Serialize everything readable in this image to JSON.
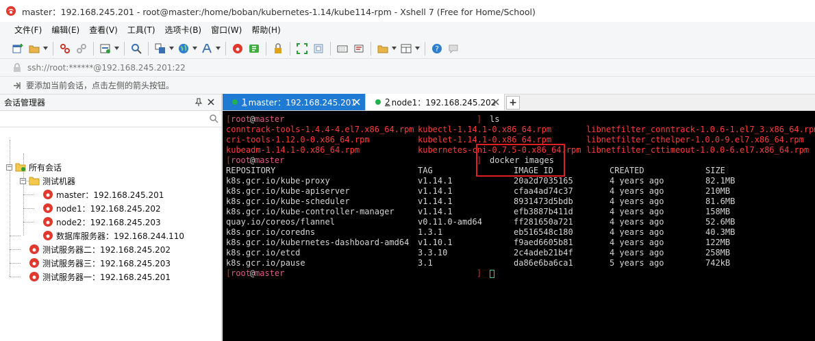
{
  "window": {
    "title": "master：192.168.245.201 - root@master:/home/boban/kubernetes-1.14/kube114-rpm - Xshell 7 (Free for Home/School)"
  },
  "menu": [
    "文件(F)",
    "编辑(E)",
    "查看(V)",
    "工具(T)",
    "选项卡(B)",
    "窗口(W)",
    "帮助(H)"
  ],
  "toolbar": {
    "icons": [
      "new-session-icon",
      "open-folder-icon",
      "disconnect-icon",
      "reconnect-icon",
      "properties-icon",
      "find-icon",
      "transfer-icon",
      "globe-icon",
      "font-icon",
      "xshell-icon",
      "xftp-icon",
      "lock-icon",
      "fullscreen-icon",
      "transparent-icon",
      "keyboard-icon",
      "compose-icon",
      "layout-icon",
      "help-icon",
      "chat-icon"
    ]
  },
  "address": {
    "url": "ssh://root:******@192.168.245.201:22"
  },
  "hint": {
    "text": "要添加当前会话，点击左侧的箭头按钮。"
  },
  "session_panel": {
    "title": "会话管理器",
    "search_placeholder": "",
    "root": "所有会话",
    "folder": "测试机器",
    "folder_items": [
      "master：192.168.245.201",
      "node1：192.168.245.202",
      "node2：192.168.245.203",
      "数据库服务器：192.168.244.110"
    ],
    "root_items": [
      "测试服务器二：192.168.245.202",
      "测试服务器三：192.168.245.203",
      "测试服务器一：192.168.245.201"
    ]
  },
  "tabs": [
    {
      "num": "1",
      "label": " master：192.168.245.201",
      "active": true
    },
    {
      "num": "2",
      "label": " node1：192.168.245.202",
      "active": false
    }
  ],
  "tab_add": "+",
  "terminal": {
    "prompt": {
      "open": "[",
      "user": "root",
      "at": "@",
      "host": "master",
      "close": "]"
    },
    "cmd1": "ls",
    "files": [
      [
        "conntrack-tools-1.4.4-4.el7.x86_64.rpm",
        "kubectl-1.14.1-0.x86_64.rpm",
        "libnetfilter_conntrack-1.0.6-1.el7_3.x86_64.rpm"
      ],
      [
        "cri-tools-1.12.0-0.x86_64.rpm",
        "kubelet-1.14.1-0.x86_64.rpm",
        "libnetfilter_cthelper-1.0.0-9.el7.x86_64.rpm"
      ],
      [
        "kubeadm-1.14.1-0.x86_64.rpm",
        "kubernetes-cni-0.7.5-0.x86_64.rpm",
        "libnetfilter_cttimeout-1.0.0-6.el7.x86_64.rpm"
      ]
    ],
    "cmd2": "docker images",
    "headers": [
      "REPOSITORY",
      "TAG",
      "IMAGE ID",
      "CREATED",
      "SIZE"
    ],
    "images": [
      [
        "k8s.gcr.io/kube-proxy",
        "v1.14.1",
        "20a2d7035165",
        "4 years ago",
        "82.1MB"
      ],
      [
        "k8s.gcr.io/kube-apiserver",
        "v1.14.1",
        "cfaa4ad74c37",
        "4 years ago",
        "210MB"
      ],
      [
        "k8s.gcr.io/kube-scheduler",
        "v1.14.1",
        "8931473d5bdb",
        "4 years ago",
        "81.6MB"
      ],
      [
        "k8s.gcr.io/kube-controller-manager",
        "v1.14.1",
        "efb3887b411d",
        "4 years ago",
        "158MB"
      ],
      [
        "quay.io/coreos/flannel",
        "v0.11.0-amd64",
        "ff281650a721",
        "4 years ago",
        "52.6MB"
      ],
      [
        "k8s.gcr.io/coredns",
        "1.3.1",
        "eb516548c180",
        "4 years ago",
        "40.3MB"
      ],
      [
        "k8s.gcr.io/kubernetes-dashboard-amd64",
        "v1.10.1",
        "f9aed6605b81",
        "4 years ago",
        "122MB"
      ],
      [
        "k8s.gcr.io/etcd",
        "3.3.10",
        "2c4adeb21b4f",
        "4 years ago",
        "258MB"
      ],
      [
        "k8s.gcr.io/pause",
        "3.1",
        "da86e6ba6ca1",
        "5 years ago",
        "742kB"
      ]
    ]
  },
  "colors": {
    "accent_tab": "#1e7ad2",
    "terminal_bg": "#000000",
    "rpm_file": "#ff3b3b",
    "highlight_box": "#e02020"
  }
}
